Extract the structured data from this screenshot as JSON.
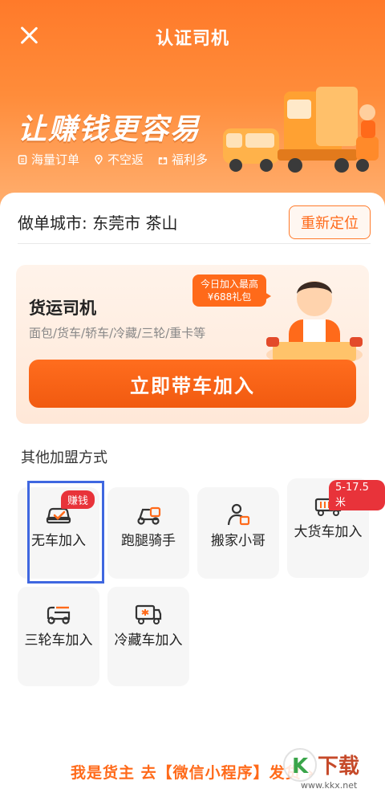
{
  "header": {
    "title": "认证司机",
    "slogan": "让赚钱更容易"
  },
  "features": [
    {
      "icon": "document-icon",
      "label": "海量订单"
    },
    {
      "icon": "location-pin-icon",
      "label": "不空返"
    },
    {
      "icon": "gift-icon",
      "label": "福利多"
    }
  ],
  "city": {
    "label": "做单城市: 东莞市 茶山",
    "relocate_label": "重新定位"
  },
  "driver_card": {
    "title": "货运司机",
    "subtitle": "面包/货车/轿车/冷藏/三轮/重卡等",
    "bonus_line1": "今日加入最高",
    "bonus_line2": "¥688礼包",
    "join_label": "立即带车加入"
  },
  "other": {
    "title": "其他加盟方式",
    "tiles": [
      {
        "label": "无车加入",
        "icon": "car-check-icon",
        "badge": "赚钱"
      },
      {
        "label": "跑腿骑手",
        "icon": "scooter-icon"
      },
      {
        "label": "搬家小哥",
        "icon": "mover-person-icon"
      },
      {
        "label": "大货车加入",
        "icon": "big-truck-icon",
        "badge": "5-17.5米"
      },
      {
        "label": "三轮车加入",
        "icon": "tricycle-icon"
      },
      {
        "label": "冷藏车加入",
        "icon": "refrigerated-truck-icon"
      }
    ]
  },
  "footer": {
    "link_label": "我是货主 去【微信小程序】发货 ›"
  },
  "watermark": {
    "text": "www.kkx.net"
  },
  "colors": {
    "brand": "#ff6a1a",
    "badge": "#e8333a",
    "highlight": "#3f67e0"
  }
}
